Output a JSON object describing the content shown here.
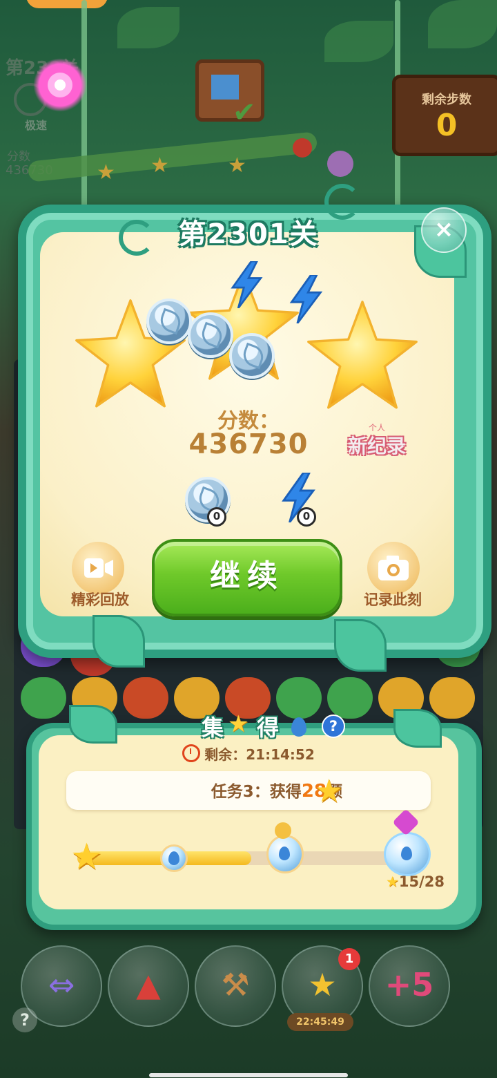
{
  "background": {
    "level_partial": "第23",
    "level_suffix": "关",
    "speed_label": "极速",
    "score_label": "分数",
    "score_value": "436730",
    "steps_label": "剩余步数",
    "steps_value": "0"
  },
  "result_popup": {
    "title": "第2301关",
    "close_symbol": "×",
    "stars_earned": 3,
    "score_label": "分数：",
    "score_value": "436730",
    "new_record_top": "个人",
    "new_record_main": "新纪录",
    "reward_coin_count": "0",
    "reward_bolt_count": "0",
    "replay_label": "精彩回放",
    "continue_label": "继续",
    "record_moment_label": "记录此刻"
  },
  "event": {
    "title_chars": [
      "集",
      "得"
    ],
    "help_symbol": "?",
    "timer_text": "剩余：21:14:52",
    "task_prefix": "任务3：获得",
    "task_number": "28",
    "task_suffix": "颗",
    "progress_current": 15,
    "progress_total": 28,
    "progress_text": "15/28"
  },
  "boosters": {
    "timer": "22:45:49",
    "badge_count": "1",
    "help_symbol": "?"
  },
  "colors": {
    "popup_frame": "#2e9f80",
    "continue_button": "#6fc92a",
    "score_text": "#b98035",
    "progress_fill": "#f4b91f"
  }
}
